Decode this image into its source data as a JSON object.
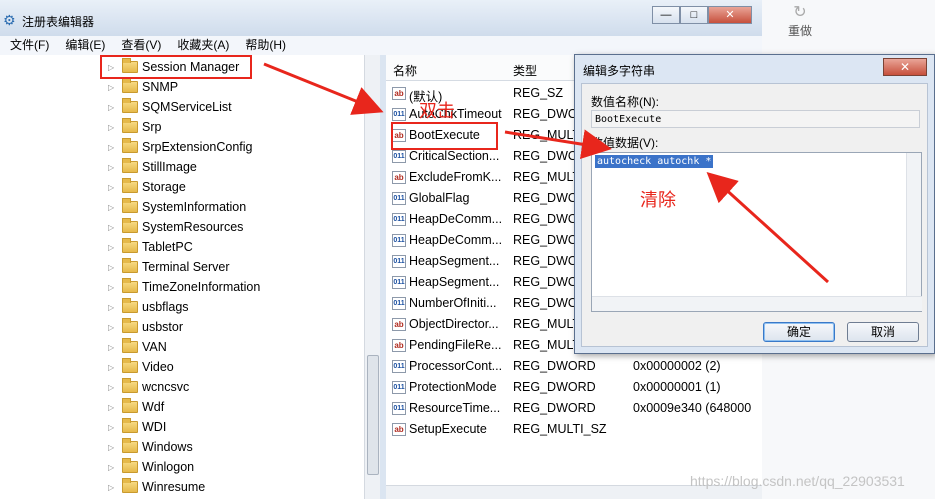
{
  "outer": {
    "redo_label": "重做",
    "redo_icon": "redo-icon"
  },
  "window": {
    "title": "注册表编辑器",
    "controls": [
      "—",
      "□",
      "✕"
    ],
    "menu": [
      "文件(F)",
      "编辑(E)",
      "查看(V)",
      "收藏夹(A)",
      "帮助(H)"
    ]
  },
  "tree": {
    "items": [
      "Session Manager",
      "SNMP",
      "SQMServiceList",
      "Srp",
      "SrpExtensionConfig",
      "StillImage",
      "Storage",
      "SystemInformation",
      "SystemResources",
      "TabletPC",
      "Terminal Server",
      "TimeZoneInformation",
      "usbflags",
      "usbstor",
      "VAN",
      "Video",
      "wcncsvc",
      "Wdf",
      "WDI",
      "Windows",
      "Winlogon",
      "Winresume"
    ]
  },
  "list": {
    "headers": {
      "name": "名称",
      "type": "类型"
    },
    "rows": [
      {
        "name": "(默认)",
        "type": "REG_SZ",
        "data": "",
        "icon": "ab"
      },
      {
        "name": "AutoChkTimeout",
        "type": "REG_DWORD",
        "data": "",
        "icon": "bin"
      },
      {
        "name": "BootExecute",
        "type": "REG_MULTI_SZ",
        "data": "",
        "icon": "ab"
      },
      {
        "name": "CriticalSection...",
        "type": "REG_DWORD",
        "data": "",
        "icon": "bin"
      },
      {
        "name": "ExcludeFromK...",
        "type": "REG_MULTI_SZ",
        "data": "",
        "icon": "ab"
      },
      {
        "name": "GlobalFlag",
        "type": "REG_DWORD",
        "data": "",
        "icon": "bin"
      },
      {
        "name": "HeapDeComm...",
        "type": "REG_DWORD",
        "data": "",
        "icon": "bin"
      },
      {
        "name": "HeapDeComm...",
        "type": "REG_DWORD",
        "data": "",
        "icon": "bin"
      },
      {
        "name": "HeapSegment...",
        "type": "REG_DWORD",
        "data": "",
        "icon": "bin"
      },
      {
        "name": "HeapSegment...",
        "type": "REG_DWORD",
        "data": "",
        "icon": "bin"
      },
      {
        "name": "NumberOfIniti...",
        "type": "REG_DWORD",
        "data": "",
        "icon": "bin"
      },
      {
        "name": "ObjectDirector...",
        "type": "REG_MULTI_SZ",
        "data": "",
        "icon": "ab"
      },
      {
        "name": "PendingFileRe...",
        "type": "REG_MULTI_SZ",
        "data": "",
        "icon": "ab"
      },
      {
        "name": "ProcessorCont...",
        "type": "REG_DWORD",
        "data": "0x00000002 (2)",
        "icon": "bin"
      },
      {
        "name": "ProtectionMode",
        "type": "REG_DWORD",
        "data": "0x00000001 (1)",
        "icon": "bin"
      },
      {
        "name": "ResourceTime...",
        "type": "REG_DWORD",
        "data": "0x0009e340 (648000",
        "icon": "bin"
      },
      {
        "name": "SetupExecute",
        "type": "REG_MULTI_SZ",
        "data": "",
        "icon": "ab"
      }
    ]
  },
  "dialog": {
    "title": "编辑多字符串",
    "close": "✕",
    "name_label": "数值名称(N):",
    "name_value": "BootExecute",
    "data_label": "数值数据(V):",
    "data_value": "autocheck autochk *",
    "ok_label": "确定",
    "cancel_label": "取消"
  },
  "annotations": {
    "double_click": "双击",
    "clear": "清除"
  },
  "watermark": "https://blog.csdn.net/qq_22903531",
  "colors": {
    "annotation": "#e8261c",
    "selection": "#3b73c9"
  }
}
